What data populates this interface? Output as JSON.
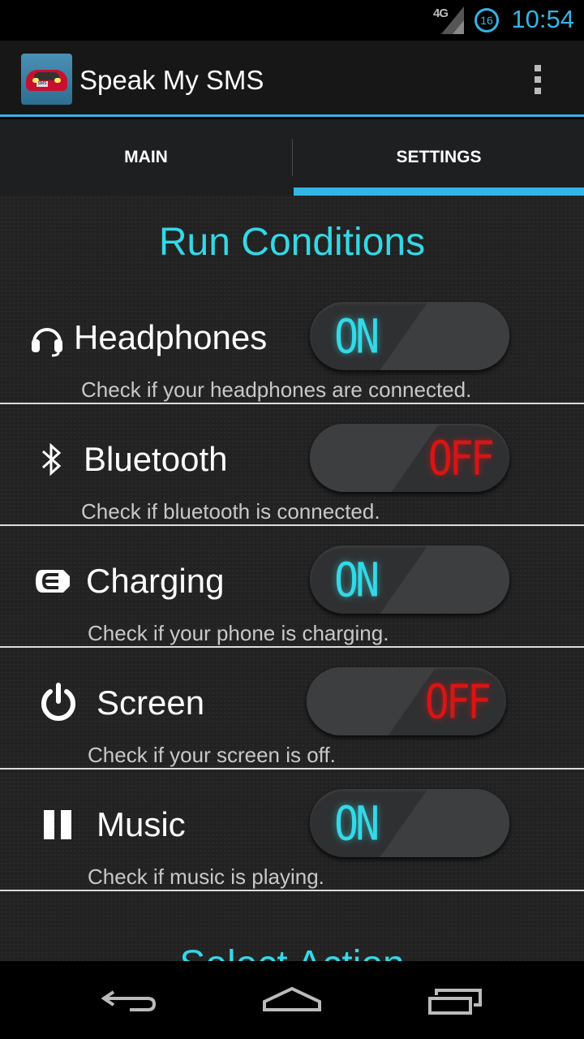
{
  "status_bar": {
    "network": "4G",
    "battery_level": "16",
    "time": "10:54"
  },
  "app": {
    "title": "Speak My SMS",
    "icon": "car-icon"
  },
  "tabs": [
    {
      "label": "MAIN",
      "selected": false
    },
    {
      "label": "SETTINGS",
      "selected": true
    }
  ],
  "section_title": "Run Conditions",
  "next_section_title": "Select Action",
  "conditions": [
    {
      "label": "Headphones",
      "icon": "headphones-icon",
      "state": "ON",
      "description": "Check if your headphones are connected."
    },
    {
      "label": "Bluetooth",
      "icon": "bluetooth-icon",
      "state": "OFF",
      "description": "Check if bluetooth is connected."
    },
    {
      "label": "Charging",
      "icon": "charging-icon",
      "state": "ON",
      "description": "Check if your phone is charging."
    },
    {
      "label": "Screen",
      "icon": "power-icon",
      "state": "OFF",
      "description": "Check if your screen is off."
    },
    {
      "label": "Music",
      "icon": "pause-icon",
      "state": "ON",
      "description": "Check if music is playing."
    }
  ],
  "colors": {
    "accent": "#33b5e5",
    "on": "#33d9e6",
    "off": "#d91414"
  },
  "nav": {
    "back": "back-icon",
    "home": "home-icon",
    "recents": "recents-icon"
  }
}
